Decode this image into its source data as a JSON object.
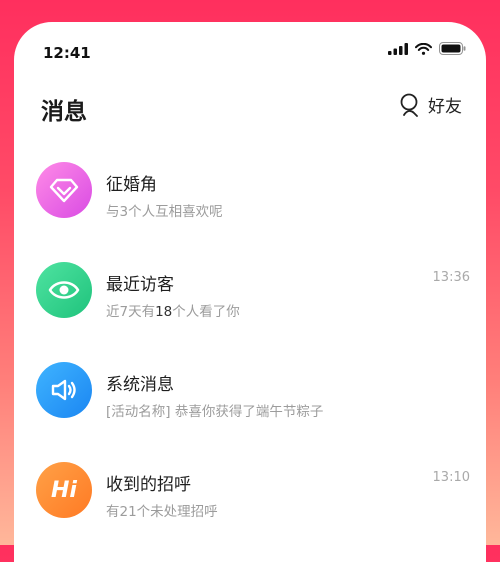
{
  "status_bar": {
    "time": "12:41"
  },
  "header": {
    "title": "消息",
    "friends_label": "好友"
  },
  "messages": [
    {
      "name": "征婚角",
      "subtitle": "与3个人互相喜欢呢",
      "time": "",
      "icon": "diamond-icon",
      "color_from": "#ff8be6",
      "color_to": "#d94be4"
    },
    {
      "name": "最近访客",
      "subtitle_prefix": "近7天有",
      "subtitle_count": "18",
      "subtitle_suffix": "个人看了你",
      "time": "13:36",
      "icon": "eye-icon",
      "color_from": "#4fe3a1",
      "color_to": "#1fc37c"
    },
    {
      "name": "系统消息",
      "subtitle": "[活动名称] 恭喜你获得了端午节粽子",
      "time": "",
      "icon": "speaker-icon",
      "color_from": "#3fb4ff",
      "color_to": "#1b86f2"
    },
    {
      "name": "收到的招呼",
      "subtitle": "有21个未处理招呼",
      "time": "13:10",
      "icon": "hi-icon",
      "icon_text": "Hi",
      "color_from": "#ffa147",
      "color_to": "#ff7a24"
    }
  ]
}
